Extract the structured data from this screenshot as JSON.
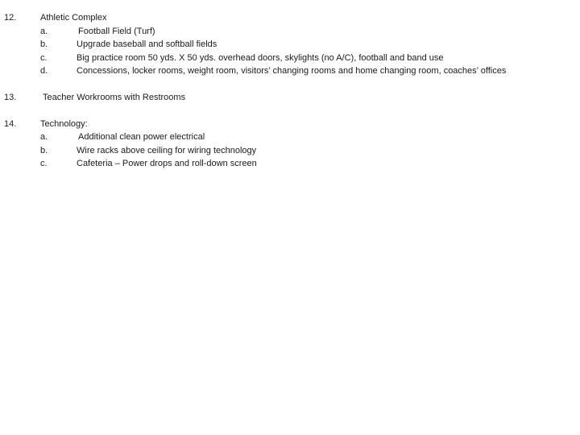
{
  "sections": [
    {
      "number": "12.",
      "title": "Athletic Complex",
      "items": [
        {
          "letter": "a.",
          "text": "Football Field (Turf)"
        },
        {
          "letter": "b.",
          "text": "Upgrade baseball and softball fields"
        },
        {
          "letter": "c.",
          "text": "Big practice room 50 yds. X 50 yds. overhead doors, skylights (no A/C), football and band use"
        },
        {
          "letter": "d.",
          "text": "Concessions, locker rooms, weight room, visitors’ changing rooms and home changing room, coaches’ offices"
        }
      ]
    },
    {
      "number": "13.",
      "title": "Teacher Workrooms with Restrooms",
      "items": []
    },
    {
      "number": "14.",
      "title": "Technology:",
      "items": [
        {
          "letter": "a.",
          "text": "Additional clean power electrical"
        },
        {
          "letter": "b.",
          "text": "Wire racks above ceiling for wiring technology"
        },
        {
          "letter": "c.",
          "text": "Cafeteria – Power drops and roll-down screen"
        }
      ]
    }
  ]
}
